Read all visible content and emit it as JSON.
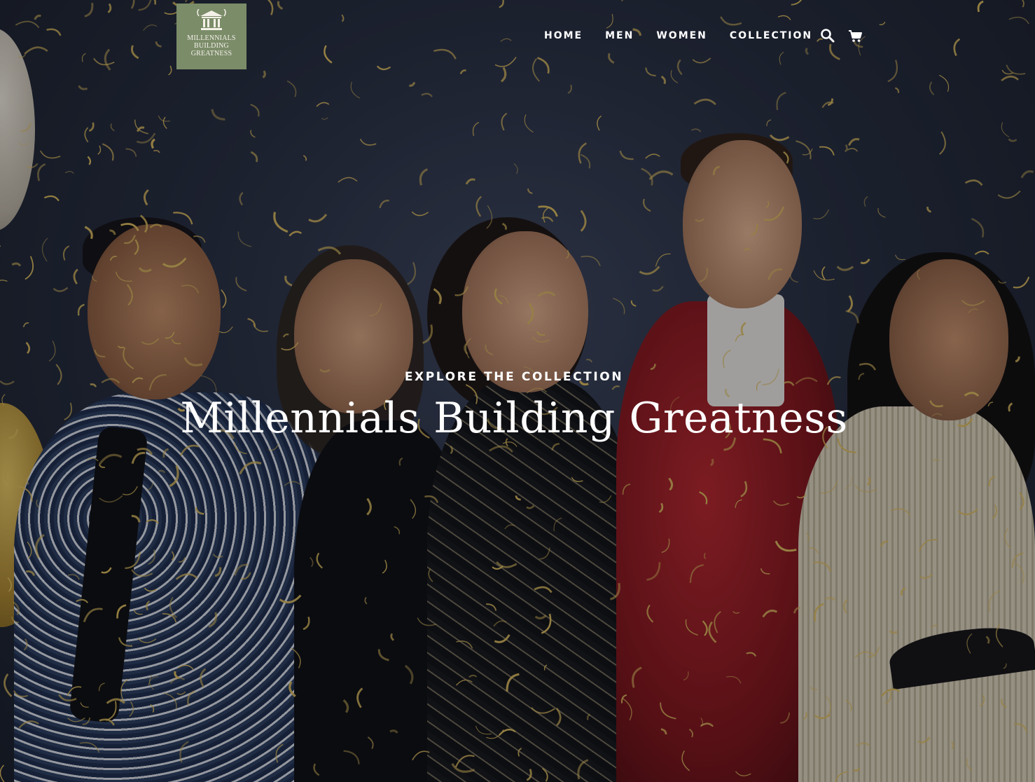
{
  "logo": {
    "text": "MILLENNIALS BUILDING GREATNESS",
    "background_color": "#7b8c69"
  },
  "nav": {
    "items": [
      {
        "label": "HOME"
      },
      {
        "label": "MEN"
      },
      {
        "label": "WOMEN"
      },
      {
        "label": "COLLECTION"
      }
    ],
    "icons": [
      "search-icon",
      "cart-icon"
    ]
  },
  "hero": {
    "eyebrow": "EXPLORE THE COLLECTION",
    "headline": "Millennials Building Greatness"
  },
  "colors": {
    "text": "#ffffff",
    "confetti": "#d9b85a"
  }
}
